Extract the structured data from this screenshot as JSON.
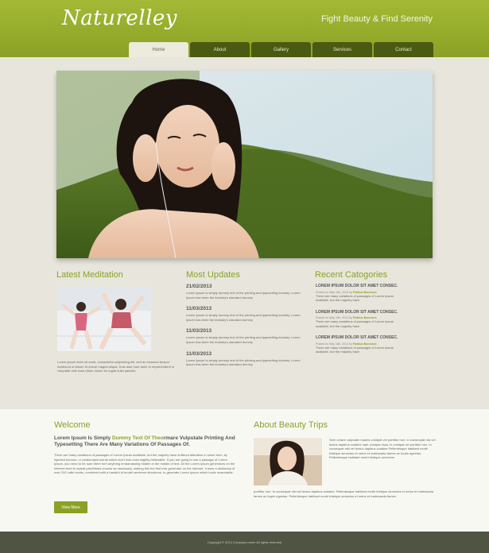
{
  "header": {
    "logo": "Naturelley",
    "tagline": "Fight Beauty & Find Serenity"
  },
  "nav": {
    "items": [
      "Home",
      "About",
      "Gallery",
      "Services",
      "Contact"
    ],
    "active_index": 0
  },
  "meditation": {
    "heading": "Latest Meditation",
    "text": "Lorem ipsum dolor sit amet, consectetur adipisicing elit, sed do eiusmod tempor incididunt ut labore et dolore magna aliqua. Duis aute irure dolor in reprehenderit in voluptate velit esse cillum dolore eu fugiat nulla pariatur."
  },
  "updates": {
    "heading": "Most Updates",
    "items": [
      {
        "date": "21/02/2013",
        "text": "Lorem Ipsum is simply dummy text of the printing and typesetting industry. Lorem Ipsum has been the industry's standard dummy"
      },
      {
        "date": "11/03/2013",
        "text": "Lorem Ipsum is simply dummy text of the printing and typesetting industry. Lorem Ipsum has been the industry's standard dummy"
      },
      {
        "date": "11/03/2013",
        "text": "Lorem Ipsum is simply dummy text of the printing and typesetting industry. Lorem Ipsum has been the industry's standard dummy"
      },
      {
        "date": "11/03/2013",
        "text": "Lorem Ipsum is simply dummy text of the printing and typesetting industry. Lorem Ipsum has been the industry's standard dummy"
      }
    ]
  },
  "categories": {
    "heading": "Recent Catogories",
    "items": [
      {
        "title": "LOREM IPSUM DOLOR SIT AMET CONSEC.",
        "posted": "Posted on May 18h, 2013 by",
        "author": "Finibus Bonorum",
        "text": "There are many variations of passages of Lorem Ipsum available, but the majority have"
      },
      {
        "title": "LOREM IPSUM DOLOR SIT AMET CONSEC.",
        "posted": "Posted on May 18h, 2013 by",
        "author": "Finibus Bonorum",
        "text": "There are many variations of passages of Lorem Ipsum available, but the majority have"
      },
      {
        "title": "LOREM IPSUM DOLOR SIT AMET CONSEC.",
        "posted": "Posted on May 18h, 2013 by",
        "author": "Finibus Bonorum",
        "text": "There are many variations of passages of Lorem Ipsum available, but the majority have"
      }
    ]
  },
  "welcome": {
    "heading": "Welcome",
    "lead_a": "Lorem Ipsum Is Simply ",
    "lead_hl": "Dummy Text Of Theo",
    "lead_b": "rmare Vulputate Printing And Typesetting There Are Many Variations Of Passages Of.",
    "body": "There are many variations of passages of Lorem Ipsum available, but the majority have suffered alteration in some form, by injected humour, or randomised words which don't look even slightly believable. If you are going to use a passage of Lorem Ipsum, you need to be sure there isn't anything embarrassing hidden in the middle of text. All the Lorem Ipsum generators on the Internet tend to repeat predefined chunks as necessary, making this the first true generator on the Internet. It uses a dictionary of over 200 Latin words, combined with a handful of model sentence structures, to generate Lorem Ipsum which looks reasonable.",
    "button": "View More"
  },
  "trips": {
    "heading": "About Beauty Trips",
    "text_side": "Sem ornare vulputate mauris volutpat vel porttitor non. In consequat nisi vel lectus dapibus sodales nam volutpat risus, in volutpat vel porttitor non. In consequat nisl vel lectus dapibus sodales Pellentesque habitant morbi tristique senectus et netus et malesuada fames ac turpis egestas. Pellentesque habitant morbi tristique senectus.",
    "text_below": "porttitor non. In consequat nisl vel lectus dapibus sodales. Pellentesque habitant morbi tristique senectus et netus et malesuada fames ac turpis egestas. Pellentesque habitant morbi tristique senectus et netus et malesuada fames."
  },
  "footer": {
    "copyright": "Copyright © 2014 Company name All rights reserved"
  },
  "colors": {
    "brand_green": "#8aa126",
    "nav_dark": "#4a5a12",
    "footer": "#505443"
  }
}
